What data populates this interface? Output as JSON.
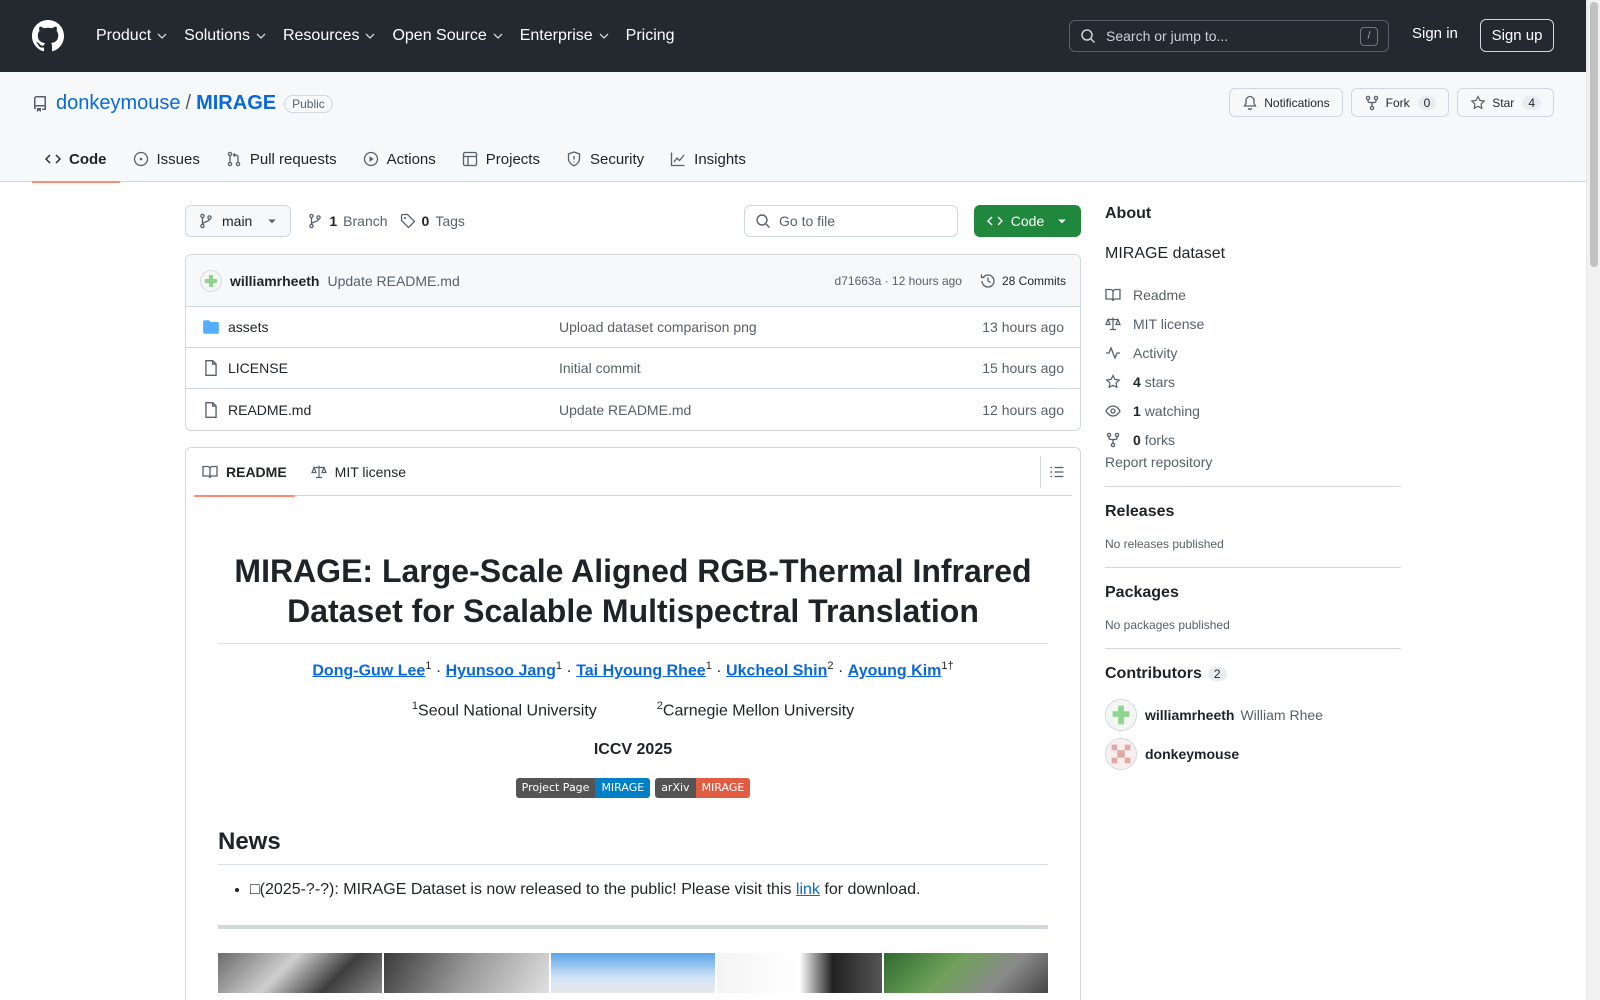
{
  "header": {
    "nav": [
      "Product",
      "Solutions",
      "Resources",
      "Open Source",
      "Enterprise",
      "Pricing"
    ],
    "search_placeholder": "Search or jump to...",
    "search_shortcut": "/",
    "signin": "Sign in",
    "signup": "Sign up"
  },
  "repo": {
    "owner": "donkeymouse",
    "sep": "/",
    "name": "MIRAGE",
    "visibility": "Public",
    "notifications": "Notifications",
    "fork_label": "Fork",
    "fork_count": "0",
    "star_label": "Star",
    "star_count": "4",
    "tabs": [
      "Code",
      "Issues",
      "Pull requests",
      "Actions",
      "Projects",
      "Security",
      "Insights"
    ]
  },
  "toolbar": {
    "branch": "main",
    "branch_count": "1",
    "branch_label": "Branch",
    "tag_count": "0",
    "tag_label": "Tags",
    "goto_placeholder": "Go to file",
    "code_button": "Code"
  },
  "commit": {
    "author": "williamrheeth",
    "message": "Update README.md",
    "sha_time": "d71663a · 12 hours ago",
    "commits": "28 Commits"
  },
  "files": [
    {
      "name": "assets",
      "type": "folder",
      "commit": "Upload dataset comparison png",
      "time": "13 hours ago"
    },
    {
      "name": "LICENSE",
      "type": "file",
      "commit": "Initial commit",
      "time": "15 hours ago"
    },
    {
      "name": "README.md",
      "type": "file",
      "commit": "Update README.md",
      "time": "12 hours ago"
    }
  ],
  "readme": {
    "tabs": [
      "README",
      "MIT license"
    ],
    "title": "MIRAGE: Large-Scale Aligned RGB-Thermal Infrared Dataset for Scalable Multispectral Translation",
    "authors": [
      {
        "name": "Dong-Guw Lee",
        "sup": "1"
      },
      {
        "name": "Hyunsoo Jang",
        "sup": "1"
      },
      {
        "name": "Tai Hyoung Rhee",
        "sup": "1"
      },
      {
        "name": "Ukcheol Shin",
        "sup": "2"
      },
      {
        "name": "Ayoung Kim",
        "sup": "1†"
      }
    ],
    "author_sep": " · ",
    "affil1_sup": "1",
    "affil1": "Seoul National University",
    "affil2_sup": "2",
    "affil2": "Carnegie Mellon University",
    "venue": "ICCV 2025",
    "badge1_left": "Project Page",
    "badge1_right": "MIRAGE",
    "badge1_color": "#007ec6",
    "badge2_left": "arXiv",
    "badge2_right": "MIRAGE",
    "badge2_color": "#e05d44",
    "news_heading": "News",
    "news_prefix": "□(2025-?-?): MIRAGE Dataset is now released to the public! Please visit this ",
    "news_link": "link",
    "news_suffix": " for download."
  },
  "sidebar": {
    "about": "About",
    "description": "MIRAGE dataset",
    "readme": "Readme",
    "license": "MIT license",
    "activity": "Activity",
    "stars_count": "4",
    "stars_label": "stars",
    "watching_count": "1",
    "watching_label": "watching",
    "forks_count": "0",
    "forks_label": "forks",
    "report": "Report repository",
    "releases": "Releases",
    "no_releases": "No releases published",
    "packages": "Packages",
    "no_packages": "No packages published",
    "contributors": "Contributors",
    "contributors_count": "2",
    "contributor_list": [
      {
        "login": "williamrheeth",
        "full": "William Rhee"
      },
      {
        "login": "donkeymouse",
        "full": ""
      }
    ]
  },
  "colors": {
    "accent_blue": "#0969da",
    "code_green": "#1f883d",
    "tab_underline": "#fd8c73",
    "header_bg": "#24292f"
  }
}
